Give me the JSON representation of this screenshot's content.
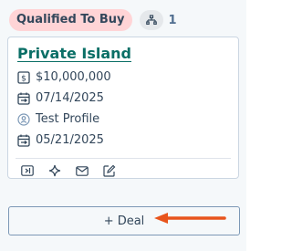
{
  "column": {
    "stage_label": "Qualified To Buy",
    "count": "1",
    "stage_color": "#ffd4d6"
  },
  "card": {
    "deal_name": "Private Island",
    "amount": "$10,000,000",
    "close_date": "07/14/2025",
    "owner": "Test Profile",
    "create_date": "05/21/2025",
    "property_icons": [
      "dollar-icon",
      "calendar-icon",
      "user-icon",
      "calendar-icon"
    ],
    "action_icons": [
      "preview-icon",
      "ai-sparkle-icon",
      "email-icon",
      "edit-icon"
    ]
  },
  "add_deal": {
    "label": "+ Deal"
  },
  "annotation": {
    "arrow_color": "#e8541c"
  }
}
